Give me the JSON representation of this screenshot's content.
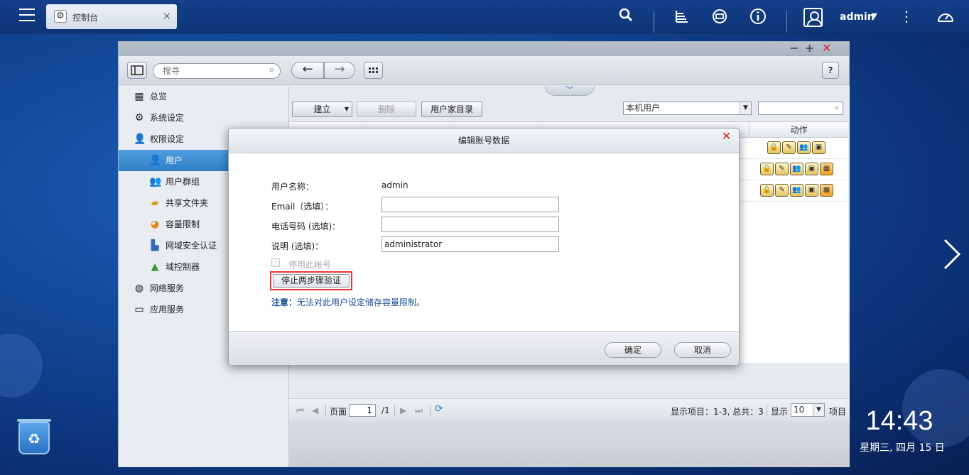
{
  "topbar": {
    "tab_label": "控制台",
    "tab_close": "×",
    "user": "admin"
  },
  "window": {
    "search_placeholder": "搜寻",
    "help": "?"
  },
  "sidebar": {
    "items": [
      {
        "label": "总览"
      },
      {
        "label": "系统设定"
      },
      {
        "label": "权限设定"
      },
      {
        "label": "用户"
      },
      {
        "label": "用户群组"
      },
      {
        "label": "共享文件夹"
      },
      {
        "label": "容量限制"
      },
      {
        "label": "网域安全认证"
      },
      {
        "label": "域控制器"
      },
      {
        "label": "网络服务"
      },
      {
        "label": "应用服务"
      }
    ]
  },
  "content": {
    "create_btn": "建立",
    "delete_btn": "删除",
    "home_btn": "用户家目录",
    "user_type": "本机用户",
    "action_col": "动作"
  },
  "pager": {
    "page_label": "页面",
    "page": "1",
    "total": "/1",
    "display_items": "显示项目：1-3, 总共：3",
    "show": "显示",
    "per_page": "10",
    "items": "项目"
  },
  "dialog": {
    "title": "编辑账号数据",
    "username_label": "用户名称：",
    "username_value": "admin",
    "email_label": "Email（选填）：",
    "email_value": "",
    "phone_label": "电话号码 (选填)：",
    "phone_value": "",
    "desc_label": "说明 (选填)：",
    "desc_value": "administrator",
    "disable_label": "停用此帐号",
    "disable_2sv_btn": "停止两步骤验证",
    "note_prefix": "注意：",
    "note_text": "无法对此用户设定储存容量限制。",
    "ok_btn": "确定",
    "cancel_btn": "取消"
  },
  "desktop": {
    "time": "14:43",
    "date": "星期三, 四月 15 日"
  },
  "colors": {
    "accent": "#2f7fc6",
    "highlight_border": "#e53935",
    "close_red": "#d21f1f"
  }
}
